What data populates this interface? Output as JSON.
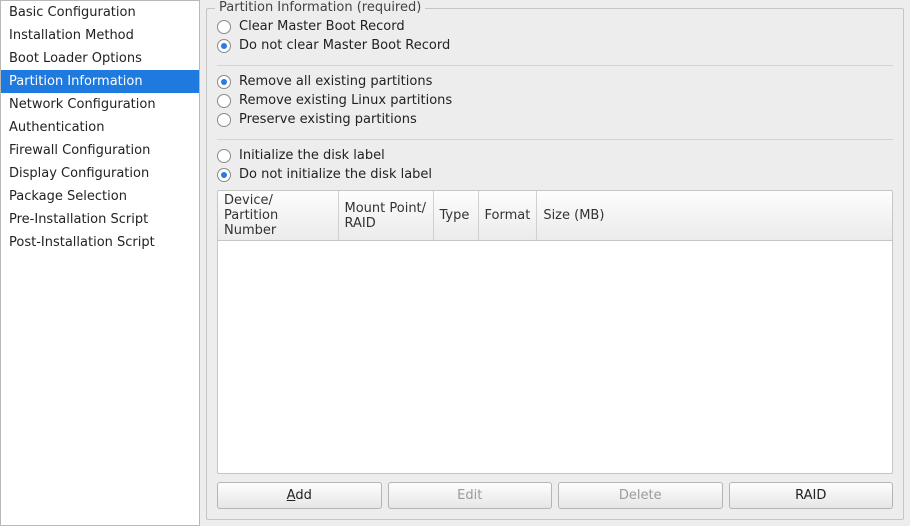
{
  "sidebar": {
    "items": [
      "Basic Configuration",
      "Installation Method",
      "Boot Loader Options",
      "Partition Information",
      "Network Configuration",
      "Authentication",
      "Firewall Configuration",
      "Display Configuration",
      "Package Selection",
      "Pre-Installation Script",
      "Post-Installation Script"
    ],
    "selected_index": 3
  },
  "group_title": "Partition Information (required)",
  "radios": {
    "mbr": {
      "clear": "Clear Master Boot Record",
      "noclear": "Do not clear Master Boot Record",
      "selected": "noclear"
    },
    "partitions": {
      "removeall": "Remove all existing partitions",
      "removelinux": "Remove existing Linux partitions",
      "preserve": "Preserve existing partitions",
      "selected": "removeall"
    },
    "disklabel": {
      "init": "Initialize the disk label",
      "noinit": "Do not initialize the disk label",
      "selected": "noinit"
    }
  },
  "table": {
    "headers": {
      "device_l1": "Device/",
      "device_l2": "Partition Number",
      "mount_l1": "Mount Point/",
      "mount_l2": "RAID",
      "type": "Type",
      "format": "Format",
      "size": "Size (MB)"
    },
    "rows": []
  },
  "buttons": {
    "add_mnemonic": "A",
    "add_rest": "dd",
    "edit": "Edit",
    "delete": "Delete",
    "raid": "RAID",
    "edit_disabled": true,
    "delete_disabled": true
  }
}
